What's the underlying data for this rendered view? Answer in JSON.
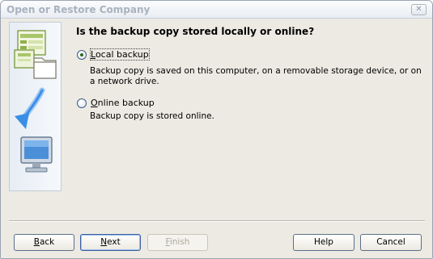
{
  "window": {
    "title": "Open or Restore Company",
    "close_glyph": "✕"
  },
  "main": {
    "question": "Is the backup copy stored locally or online?",
    "options": [
      {
        "label_mnemonic": "L",
        "label_rest": "ocal backup",
        "selected": true,
        "description_line1": "Backup copy is saved on this computer, on a removable storage device, or on",
        "description_line2": "a network drive."
      },
      {
        "label_mnemonic": "O",
        "label_rest": "nline backup",
        "selected": false,
        "description_line1": "Backup copy is stored online."
      }
    ]
  },
  "footer": {
    "back_mnemonic": "B",
    "back_rest": "ack",
    "next_mnemonic": "N",
    "next_rest": "ext",
    "finish_mnemonic": "F",
    "finish_rest": "inish",
    "help_label": "Help",
    "cancel_label": "Cancel"
  },
  "illustration": {
    "icons": [
      "company-file-icon",
      "folder-icon",
      "arrow-icon",
      "monitor-icon"
    ]
  },
  "colors": {
    "accent_arrow": "#3a8ee6",
    "radio_dot": "#2b6a1f"
  }
}
